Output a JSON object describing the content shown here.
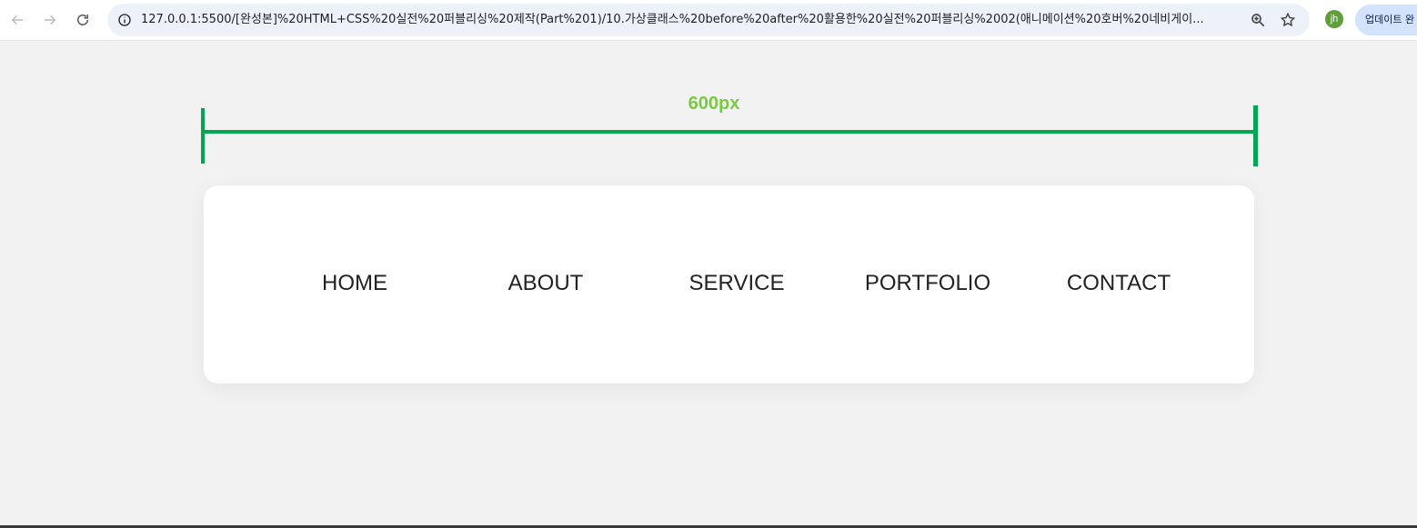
{
  "browser": {
    "url": "127.0.0.1:5500/[완성본]%20HTML+CSS%20실전%20퍼블리싱%20제작(Part%201)/10.가상클래스%20before%20after%20활용한%20실전%20퍼블리싱%2002(애니메이션%20호버%20네비게이...",
    "profile_initials": "jh",
    "update_button_label": "업데이트 완",
    "icons": {
      "back": "arrow-left-icon",
      "forward": "arrow-right-icon",
      "reload": "reload-icon",
      "site_info": "info-icon",
      "zoom": "zoom-icon",
      "bookmark": "star-icon"
    },
    "colors": {
      "omnibox_bg": "#edf2fa",
      "avatar_bg": "#5f9f3a",
      "update_bg": "#d3e3fd"
    }
  },
  "page": {
    "measure_label": "600px",
    "colors": {
      "measure_line": "#00a651",
      "measure_label": "#7ac943",
      "background": "#f2f2f2",
      "card": "#ffffff"
    },
    "menu": [
      {
        "label": "HOME"
      },
      {
        "label": "ABOUT"
      },
      {
        "label": "SERVICE"
      },
      {
        "label": "PORTFOLIO"
      },
      {
        "label": "CONTACT"
      }
    ]
  }
}
